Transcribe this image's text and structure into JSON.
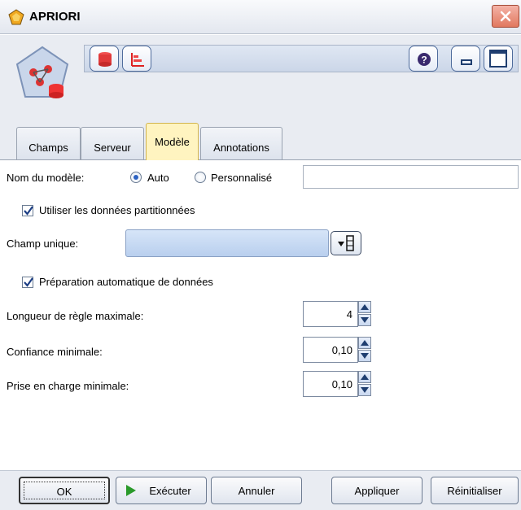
{
  "window": {
    "title": "APRIORI"
  },
  "toolbar": {
    "icons": [
      "database-icon",
      "bar-chart-icon"
    ],
    "right_icons": [
      "help-icon",
      "minimize-icon",
      "maximize-icon"
    ]
  },
  "tabs": [
    {
      "label": "Champs"
    },
    {
      "label": "Serveur"
    },
    {
      "label": "Modèle"
    },
    {
      "label": "Annotations"
    }
  ],
  "form": {
    "model_name_label": "Nom du modèle:",
    "radio_auto": "Auto",
    "radio_custom": "Personnalisé",
    "model_name_value": "",
    "use_partitioned": "Utiliser les données partitionnées",
    "single_field_label": "Champ unique:",
    "single_field_value": "",
    "auto_prep": "Préparation automatique de données",
    "max_rule_length_label": "Longueur de règle maximale:",
    "max_rule_length_value": "4",
    "min_confidence_label": "Confiance minimale:",
    "min_confidence_value": "0,10",
    "min_support_label": "Prise en charge minimale:",
    "min_support_value": "0,10"
  },
  "buttons": {
    "ok": "OK",
    "execute": "Exécuter",
    "cancel": "Annuler",
    "apply": "Appliquer",
    "reset": "Réinitialiser"
  }
}
